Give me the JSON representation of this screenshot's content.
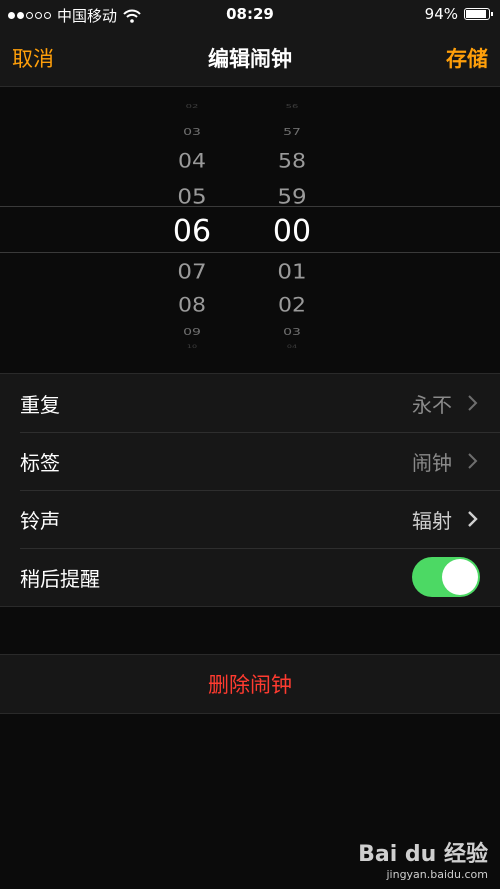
{
  "status_bar": {
    "carrier": "中国移动",
    "time": "08:29",
    "battery_percent": "94%",
    "battery_level": 0.94
  },
  "nav": {
    "cancel": "取消",
    "title": "编辑闹钟",
    "save": "存储"
  },
  "picker": {
    "hours": [
      "02",
      "03",
      "04",
      "05",
      "06",
      "07",
      "08",
      "09",
      "10"
    ],
    "minutes": [
      "56",
      "57",
      "58",
      "59",
      "00",
      "01",
      "02",
      "03",
      "04"
    ],
    "selected_hour": "06",
    "selected_minute": "00"
  },
  "settings": {
    "repeat_label": "重复",
    "repeat_value": "永不",
    "tag_label": "标签",
    "tag_value": "闹钟",
    "sound_label": "铃声",
    "sound_value": "辐射",
    "snooze_label": "稍后提醒",
    "snooze_on": true
  },
  "delete_label": "删除闹钟",
  "watermark": {
    "logo": "Bai du 经验",
    "url": "jingyan.baidu.com"
  },
  "colors": {
    "accent": "#ff9f0a",
    "destructive": "#ff3b30",
    "toggle_on": "#4cd964"
  }
}
